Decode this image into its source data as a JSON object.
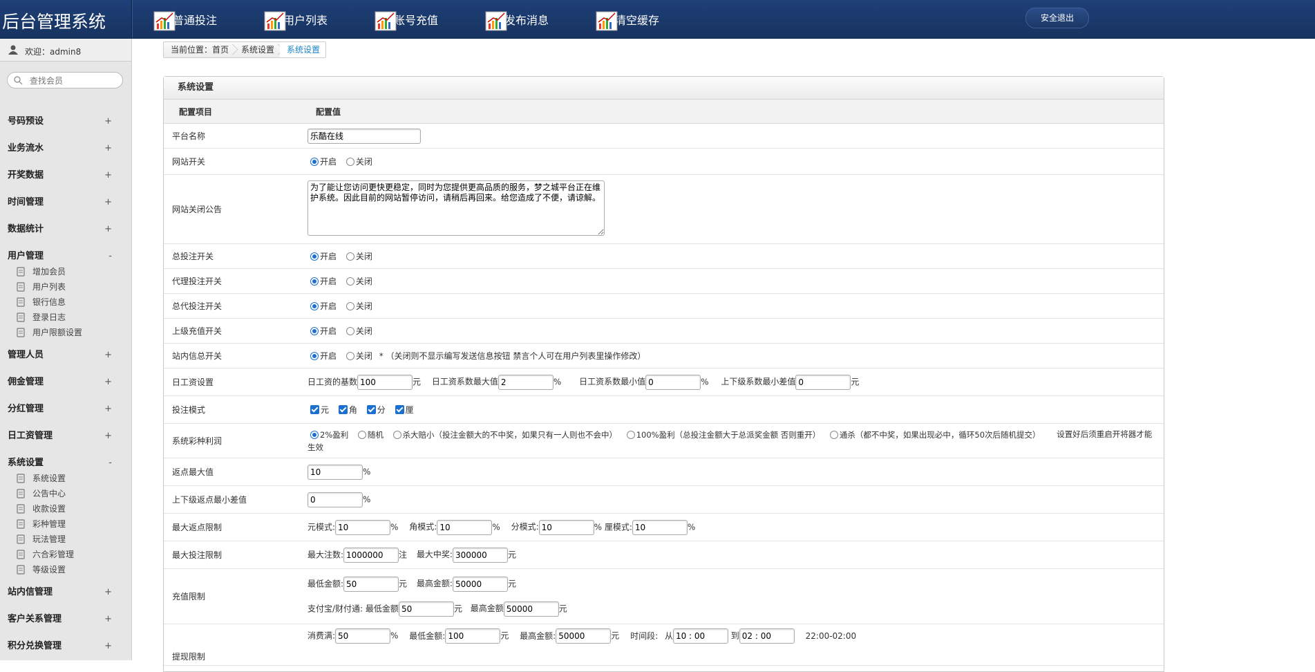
{
  "app": {
    "title": "后台管理系统"
  },
  "topnav": {
    "items": [
      {
        "label": "普通投注"
      },
      {
        "label": "用户列表"
      },
      {
        "label": "账号充值"
      },
      {
        "label": "发布消息"
      },
      {
        "label": "清空缓存"
      }
    ],
    "logout_label": "安全退出"
  },
  "sidebar": {
    "welcome": "欢迎：admin8",
    "search_placeholder": "查找会员",
    "groups": [
      {
        "label": "号码预设",
        "toggle": "+"
      },
      {
        "label": "业务流水",
        "toggle": "+"
      },
      {
        "label": "开奖数据",
        "toggle": "+"
      },
      {
        "label": "时间管理",
        "toggle": "+"
      },
      {
        "label": "数据统计",
        "toggle": "+"
      },
      {
        "label": "用户管理",
        "toggle": "-",
        "items": [
          "增加会员",
          "用户列表",
          "银行信息",
          "登录日志",
          "用户限额设置"
        ]
      },
      {
        "label": "管理人员",
        "toggle": "+"
      },
      {
        "label": "佣金管理",
        "toggle": "+"
      },
      {
        "label": "分红管理",
        "toggle": "+"
      },
      {
        "label": "日工资管理",
        "toggle": "+"
      },
      {
        "label": "系统设置",
        "toggle": "-",
        "items": [
          "系统设置",
          "公告中心",
          "收款设置",
          "彩种管理",
          "玩法管理",
          "六合彩管理",
          "等级设置"
        ]
      },
      {
        "label": "站内信管理",
        "toggle": "+"
      },
      {
        "label": "客户关系管理",
        "toggle": "+"
      },
      {
        "label": "积分兑换管理",
        "toggle": "+"
      }
    ]
  },
  "breadcrumb": {
    "prefix": "当前位置：首页",
    "parent": "系统设置",
    "current": "系统设置"
  },
  "panel": {
    "title": "系统设置",
    "col_item": "配置项目",
    "col_value": "配置值"
  },
  "settings": {
    "on": "开启",
    "off": "关闭",
    "platform_name": {
      "label": "平台名称",
      "value": "乐酷在线"
    },
    "site_switch": {
      "label": "网站开关",
      "state": "on"
    },
    "close_notice": {
      "label": "网站关闭公告",
      "value": "为了能让您访问更快更稳定，同时为您提供更高品质的服务，梦之城平台正在维护系统。因此目前的网站暂停访问，请稍后再回来。给您造成了不便，请谅解。"
    },
    "total_bet_switch": {
      "label": "总投注开关",
      "state": "on"
    },
    "agent_bet_switch": {
      "label": "代理投注开关",
      "state": "on"
    },
    "general_agent_bet_switch": {
      "label": "总代投注开关",
      "state": "on"
    },
    "upper_recharge_switch": {
      "label": "上级充值开关",
      "state": "on"
    },
    "internal_msg_switch": {
      "label": "站内信总开关",
      "state": "on",
      "note": "* （关闭则不显示编写发送信息按钮 禁言个人可在用户列表里操作修改）"
    },
    "daily_wage": {
      "label": "日工资设置",
      "base_label": "日工资的基数",
      "base_value": "100",
      "base_unit": "元",
      "max_label": "日工资系数最大值",
      "max_value": "2",
      "max_unit": "%",
      "min_label": "日工资系数最小值",
      "min_value": "0",
      "min_unit": "%",
      "diff_label": "上下级系数最小差值",
      "diff_value": "0",
      "diff_unit": "元"
    },
    "bet_mode": {
      "label": "投注模式",
      "options": [
        "元",
        "角",
        "分",
        "厘"
      ]
    },
    "lottery_profit": {
      "label": "系统彩种利润",
      "options": [
        {
          "text": "2%盈利",
          "state": "on"
        },
        {
          "text": "随机",
          "state": "off"
        },
        {
          "text": "杀大赔小（投注金额大的不中奖，如果只有一人则也不会中）",
          "state": "off"
        },
        {
          "text": "100%盈利（总投注金额大于总派奖金额 否则重开）",
          "state": "off"
        },
        {
          "text": "通杀（都不中奖，如果出现必中，循环50次后随机提交）",
          "state": "off"
        }
      ],
      "note": "设置好后须重启开将器才能生效"
    },
    "rebate_max": {
      "label": "返点最大值",
      "value": "10",
      "unit": "%"
    },
    "rebate_min_diff": {
      "label": "上下级返点最小差值",
      "value": "0",
      "unit": "%"
    },
    "max_rebate_limit": {
      "label": "最大返点限制",
      "modes": [
        {
          "label": "元模式:",
          "value": "10",
          "unit": "%"
        },
        {
          "label": "角模式:",
          "value": "10",
          "unit": "%"
        },
        {
          "label": "分模式:",
          "value": "10",
          "unit": "%"
        },
        {
          "label": "厘模式:",
          "value": "10",
          "unit": "%"
        }
      ]
    },
    "max_bet_limit": {
      "label": "最大投注限制",
      "max_bets_label": "最大注数:",
      "max_bets_value": "1000000",
      "max_bets_unit": "注",
      "max_win_label": "最大中奖:",
      "max_win_value": "300000",
      "max_win_unit": "元"
    },
    "recharge_limit": {
      "label": "充值限制",
      "min_label": "最低金额:",
      "min_value": "50",
      "min_unit": "元",
      "max_label": "最高金额:",
      "max_value": "50000",
      "max_unit": "元",
      "alipay_prefix": "支付宝/财付通:",
      "alipay_min_label": "最低金额",
      "alipay_min_value": "50",
      "alipay_min_unit": "元",
      "alipay_max_label": "最高金额",
      "alipay_max_value": "50000",
      "alipay_max_unit": "元"
    },
    "withdraw_limit": {
      "label": "提现限制",
      "consume_label": "消费满:",
      "consume_value": "50",
      "consume_unit": "%",
      "min_label": "最低金额:",
      "min_value": "100",
      "min_unit": "元",
      "max_label": "最高金额:",
      "max_value": "50000",
      "max_unit": "元",
      "time_label": "时间段:",
      "from_label": "从",
      "from_value": "10 : 00",
      "to_label": "到",
      "to_value": "02 : 00",
      "range_text": "22:00-02:00"
    }
  }
}
